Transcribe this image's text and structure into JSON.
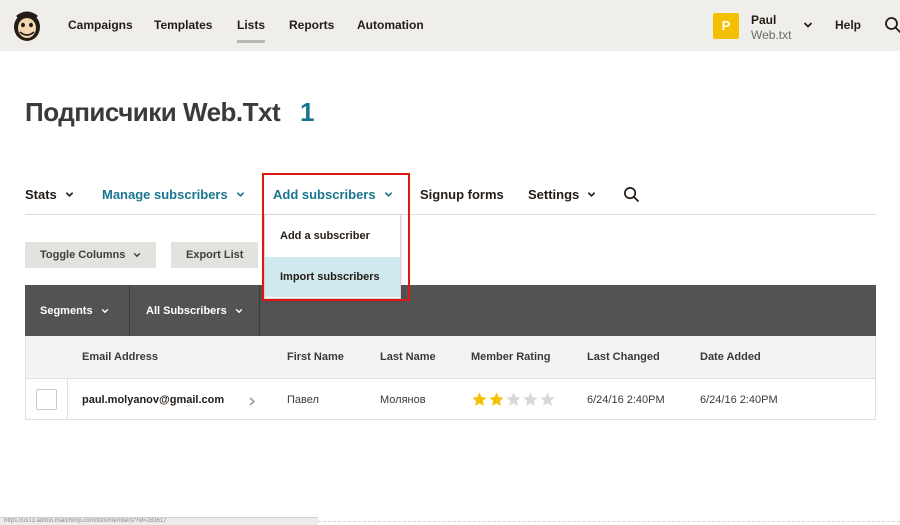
{
  "nav": {
    "items": [
      "Campaigns",
      "Templates",
      "Lists",
      "Reports",
      "Automation"
    ],
    "active": "Lists",
    "user": {
      "avatar_letter": "P",
      "name": "Paul",
      "org": "Web.txt"
    },
    "help": "Help"
  },
  "page": {
    "title": "Подписчики Web.Txt",
    "count": "1"
  },
  "subnav": {
    "stats": "Stats",
    "manage": "Manage subscribers",
    "add": "Add subscribers",
    "signup": "Signup forms",
    "settings": "Settings"
  },
  "toolbar": {
    "toggle_columns": "Toggle Columns",
    "export_list": "Export List"
  },
  "dropdown": {
    "items": [
      "Add a subscriber",
      "Import subscribers"
    ],
    "selected": "Import subscribers"
  },
  "filters": {
    "segments": "Segments",
    "all_subscribers": "All Subscribers"
  },
  "table": {
    "columns": [
      "Email Address",
      "First Name",
      "Last Name",
      "Member Rating",
      "Last Changed",
      "Date Added"
    ],
    "rows": [
      {
        "email": "paul.molyanov@gmail.com",
        "first_name": "Павел",
        "last_name": "Молянов",
        "rating": 2,
        "rating_max": 5,
        "last_changed": "6/24/16 2:40PM",
        "date_added": "6/24/16 2:40PM"
      }
    ]
  },
  "status_url": "https://us13.admin.mailchimp.com/lists/members/?id=283617",
  "colors": {
    "accent": "#1a7590",
    "highlight": "#e01616",
    "star_on": "#f5c000",
    "star_off": "#d8d8d8",
    "avatar": "#f5c000"
  },
  "icons": [
    "freddie-logo-icon",
    "chevron-down-icon",
    "search-icon",
    "chevron-right-icon",
    "star-icon"
  ]
}
